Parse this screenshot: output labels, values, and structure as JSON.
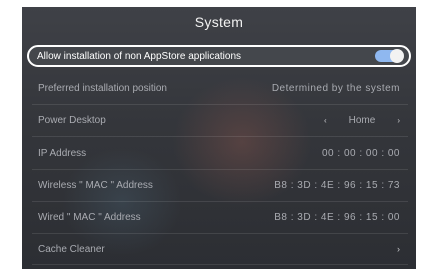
{
  "header": {
    "title": "System"
  },
  "rows": {
    "allow_install": {
      "label": "Allow installation of non AppStore applications",
      "toggle_on": true
    },
    "preferred_position": {
      "label": "Preferred installation position",
      "value": "Determined by the system"
    },
    "power_desktop": {
      "label": "Power Desktop",
      "value": "Home",
      "left_arrow": "‹",
      "right_arrow": "›"
    },
    "ip_address": {
      "label": "IP Address",
      "value": "00 : 00 : 00 : 00"
    },
    "wireless_mac": {
      "label": "Wireless \" MAC \" Address",
      "value": "B8 : 3D : 4E : 96 : 15 : 73"
    },
    "wired_mac": {
      "label": "Wired \" MAC \" Address",
      "value": "B8 : 3D : 4E : 96 : 15 : 00"
    },
    "cache_cleaner": {
      "label": "Cache Cleaner",
      "chevron": "›"
    }
  },
  "colors": {
    "toggle_track": "#8fb8f0",
    "panel": "#3a3c41"
  }
}
